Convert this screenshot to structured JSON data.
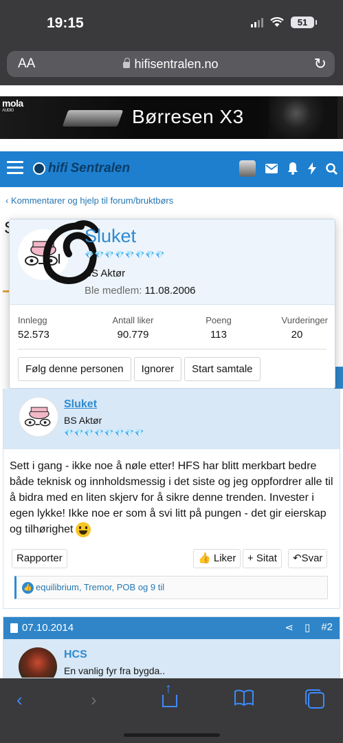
{
  "status": {
    "time": "19:15",
    "battery": "51"
  },
  "browser": {
    "text_size_label": "AA",
    "url": "hifisentralen.no"
  },
  "banner": {
    "brand": "mola",
    "brand_sub": "AUDIO",
    "title": "Børresen X3"
  },
  "site": {
    "logo_hifi": "hifi",
    "logo_sentralen": "Sentralen"
  },
  "breadcrumb": {
    "label": "Kommentarer og hjelp til forum/bruktbørs"
  },
  "page": {
    "title_initial": "S"
  },
  "popover": {
    "username": "Sluket",
    "rank_icon_count": 8,
    "title": "BS Aktør",
    "joined_label": "Ble medlem:",
    "joined_date": "11.08.2006",
    "stats": [
      {
        "label": "Innlegg",
        "value": "52.573"
      },
      {
        "label": "Antall liker",
        "value": "90.779"
      },
      {
        "label": "Poeng",
        "value": "113"
      },
      {
        "label": "Vurderinger",
        "value": "20"
      }
    ],
    "buttons": {
      "follow": "Følg denne personen",
      "ignore": "Ignorer",
      "conversation": "Start samtale"
    }
  },
  "post1": {
    "username": "Sluket",
    "user_title": "BS Aktør",
    "body": "Sett i gang - ikke noe å nøle etter! HFS har blitt merkbart bedre både teknisk og innholdsmessig i det siste og jeg oppfordrer alle til å bidra med en liten skjerv for å sikre denne trenden. Invester i egen lykke! Ikke noe er som å svi litt på pungen - det gir eierskap og tilhørighet",
    "actions": {
      "report": "Rapporter",
      "like": "Liker",
      "quote": "+ Sitat",
      "reply": "Svar"
    },
    "reactions": "equilibrium, Tremor, POB og 9 til"
  },
  "post2": {
    "date": "07.10.2014",
    "number": "#2",
    "username": "HCS",
    "user_title": "En vanlig fyr fra bygda.."
  },
  "colors": {
    "accent": "#1e7fcf",
    "link": "#2d8ad1",
    "rank": "#ea86b4",
    "safari_blue": "#3d8bfd"
  }
}
